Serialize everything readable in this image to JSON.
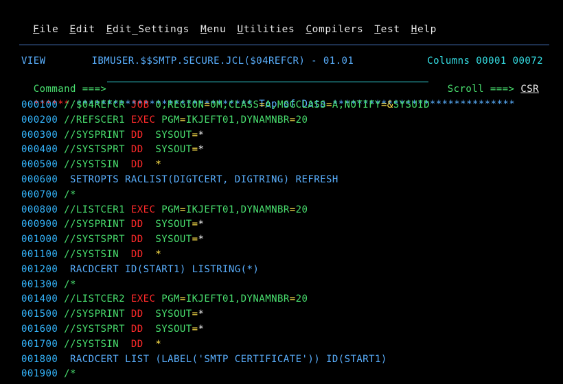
{
  "menu": {
    "items": [
      {
        "mnemonic": "F",
        "rest": "ile"
      },
      {
        "mnemonic": "E",
        "rest": "dit"
      },
      {
        "mnemonic": "E",
        "rest": "dit_Settings"
      },
      {
        "mnemonic": "M",
        "rest": "enu"
      },
      {
        "mnemonic": "U",
        "rest": "tilities"
      },
      {
        "mnemonic": "C",
        "rest": "ompilers"
      },
      {
        "mnemonic": "T",
        "rest": "est"
      },
      {
        "mnemonic": "H",
        "rest": "elp"
      }
    ]
  },
  "header": {
    "mode": "VIEW",
    "dataset": "IBMUSER.$$SMTP.SECURE.JCL($04REFCR) - 01.01",
    "columns": "Columns 00001 00072"
  },
  "command": {
    "label": "Command ===>",
    "value": "",
    "scroll_label": "Scroll ===>",
    "scroll_value": "CSR"
  },
  "top_of_data": "****** ***************************** Top of Data ******************************",
  "lines": [
    {
      "num": "000100",
      "segments": [
        {
          "t": "//$04REFCR ",
          "c": "c-green"
        },
        {
          "t": "JOB",
          "c": "c-red"
        },
        {
          "t": " 0,REGION",
          "c": "c-green"
        },
        {
          "t": "=",
          "c": "c-yellow"
        },
        {
          "t": "0M,CLASS",
          "c": "c-green"
        },
        {
          "t": "=",
          "c": "c-yellow"
        },
        {
          "t": "A,MSGCLASS",
          "c": "c-green"
        },
        {
          "t": "=",
          "c": "c-yellow"
        },
        {
          "t": "A,NOTIFY",
          "c": "c-green"
        },
        {
          "t": "=",
          "c": "c-yellow"
        },
        {
          "t": "&",
          "c": "c-yellow"
        },
        {
          "t": "SYSUID",
          "c": "c-green"
        }
      ]
    },
    {
      "num": "000200",
      "segments": [
        {
          "t": "//REFSCER1 ",
          "c": "c-green"
        },
        {
          "t": "EXEC",
          "c": "c-red"
        },
        {
          "t": " PGM",
          "c": "c-green"
        },
        {
          "t": "=",
          "c": "c-yellow"
        },
        {
          "t": "IKJEFT01,DYNAMNBR",
          "c": "c-green"
        },
        {
          "t": "=",
          "c": "c-yellow"
        },
        {
          "t": "20",
          "c": "c-green"
        }
      ]
    },
    {
      "num": "000300",
      "segments": [
        {
          "t": "//SYSPRINT ",
          "c": "c-green"
        },
        {
          "t": "DD",
          "c": "c-red"
        },
        {
          "t": "  SYSOUT",
          "c": "c-green"
        },
        {
          "t": "=",
          "c": "c-yellow"
        },
        {
          "t": "*",
          "c": "c-white"
        }
      ]
    },
    {
      "num": "000400",
      "segments": [
        {
          "t": "//SYSTSPRT ",
          "c": "c-green"
        },
        {
          "t": "DD",
          "c": "c-red"
        },
        {
          "t": "  SYSOUT",
          "c": "c-green"
        },
        {
          "t": "=",
          "c": "c-yellow"
        },
        {
          "t": "*",
          "c": "c-white"
        }
      ]
    },
    {
      "num": "000500",
      "segments": [
        {
          "t": "//SYSTSIN  ",
          "c": "c-green"
        },
        {
          "t": "DD",
          "c": "c-red"
        },
        {
          "t": "  *",
          "c": "c-yellow"
        }
      ]
    },
    {
      "num": "000600",
      "segments": [
        {
          "t": " SETROPTS RACLIST(DIGTCERT, DIGTRING) REFRESH",
          "c": "c-blue"
        }
      ]
    },
    {
      "num": "000700",
      "segments": [
        {
          "t": "/*",
          "c": "c-green"
        }
      ]
    },
    {
      "num": "000800",
      "segments": [
        {
          "t": "//LISTCER1 ",
          "c": "c-green"
        },
        {
          "t": "EXEC",
          "c": "c-red"
        },
        {
          "t": " PGM",
          "c": "c-green"
        },
        {
          "t": "=",
          "c": "c-yellow"
        },
        {
          "t": "IKJEFT01,DYNAMNBR",
          "c": "c-green"
        },
        {
          "t": "=",
          "c": "c-yellow"
        },
        {
          "t": "20",
          "c": "c-green"
        }
      ]
    },
    {
      "num": "000900",
      "segments": [
        {
          "t": "//SYSPRINT ",
          "c": "c-green"
        },
        {
          "t": "DD",
          "c": "c-red"
        },
        {
          "t": "  SYSOUT",
          "c": "c-green"
        },
        {
          "t": "=",
          "c": "c-yellow"
        },
        {
          "t": "*",
          "c": "c-white"
        }
      ]
    },
    {
      "num": "001000",
      "segments": [
        {
          "t": "//SYSTSPRT ",
          "c": "c-green"
        },
        {
          "t": "DD",
          "c": "c-red"
        },
        {
          "t": "  SYSOUT",
          "c": "c-green"
        },
        {
          "t": "=",
          "c": "c-yellow"
        },
        {
          "t": "*",
          "c": "c-white"
        }
      ]
    },
    {
      "num": "001100",
      "segments": [
        {
          "t": "//SYSTSIN  ",
          "c": "c-green"
        },
        {
          "t": "DD",
          "c": "c-red"
        },
        {
          "t": "  *",
          "c": "c-yellow"
        }
      ]
    },
    {
      "num": "001200",
      "segments": [
        {
          "t": " RACDCERT ID(START1) LISTRING(*)",
          "c": "c-blue"
        }
      ]
    },
    {
      "num": "001300",
      "segments": [
        {
          "t": "/*",
          "c": "c-green"
        }
      ]
    },
    {
      "num": "001400",
      "segments": [
        {
          "t": "//LISTCER2 ",
          "c": "c-green"
        },
        {
          "t": "EXEC",
          "c": "c-red"
        },
        {
          "t": " PGM",
          "c": "c-green"
        },
        {
          "t": "=",
          "c": "c-yellow"
        },
        {
          "t": "IKJEFT01,DYNAMNBR",
          "c": "c-green"
        },
        {
          "t": "=",
          "c": "c-yellow"
        },
        {
          "t": "20",
          "c": "c-green"
        }
      ]
    },
    {
      "num": "001500",
      "segments": [
        {
          "t": "//SYSPRINT ",
          "c": "c-green"
        },
        {
          "t": "DD",
          "c": "c-red"
        },
        {
          "t": "  SYSOUT",
          "c": "c-green"
        },
        {
          "t": "=",
          "c": "c-yellow"
        },
        {
          "t": "*",
          "c": "c-white"
        }
      ]
    },
    {
      "num": "001600",
      "segments": [
        {
          "t": "//SYSTSPRT ",
          "c": "c-green"
        },
        {
          "t": "DD",
          "c": "c-red"
        },
        {
          "t": "  SYSOUT",
          "c": "c-green"
        },
        {
          "t": "=",
          "c": "c-yellow"
        },
        {
          "t": "*",
          "c": "c-white"
        }
      ]
    },
    {
      "num": "001700",
      "segments": [
        {
          "t": "//SYSTSIN  ",
          "c": "c-green"
        },
        {
          "t": "DD",
          "c": "c-red"
        },
        {
          "t": "  *",
          "c": "c-yellow"
        }
      ]
    },
    {
      "num": "001800",
      "segments": [
        {
          "t": " RACDCERT LIST (LABEL('SMTP CERTIFICATE')) ID(START1)",
          "c": "c-blue"
        }
      ]
    },
    {
      "num": "001900",
      "segments": [
        {
          "t": "/*",
          "c": "c-green"
        }
      ]
    }
  ]
}
